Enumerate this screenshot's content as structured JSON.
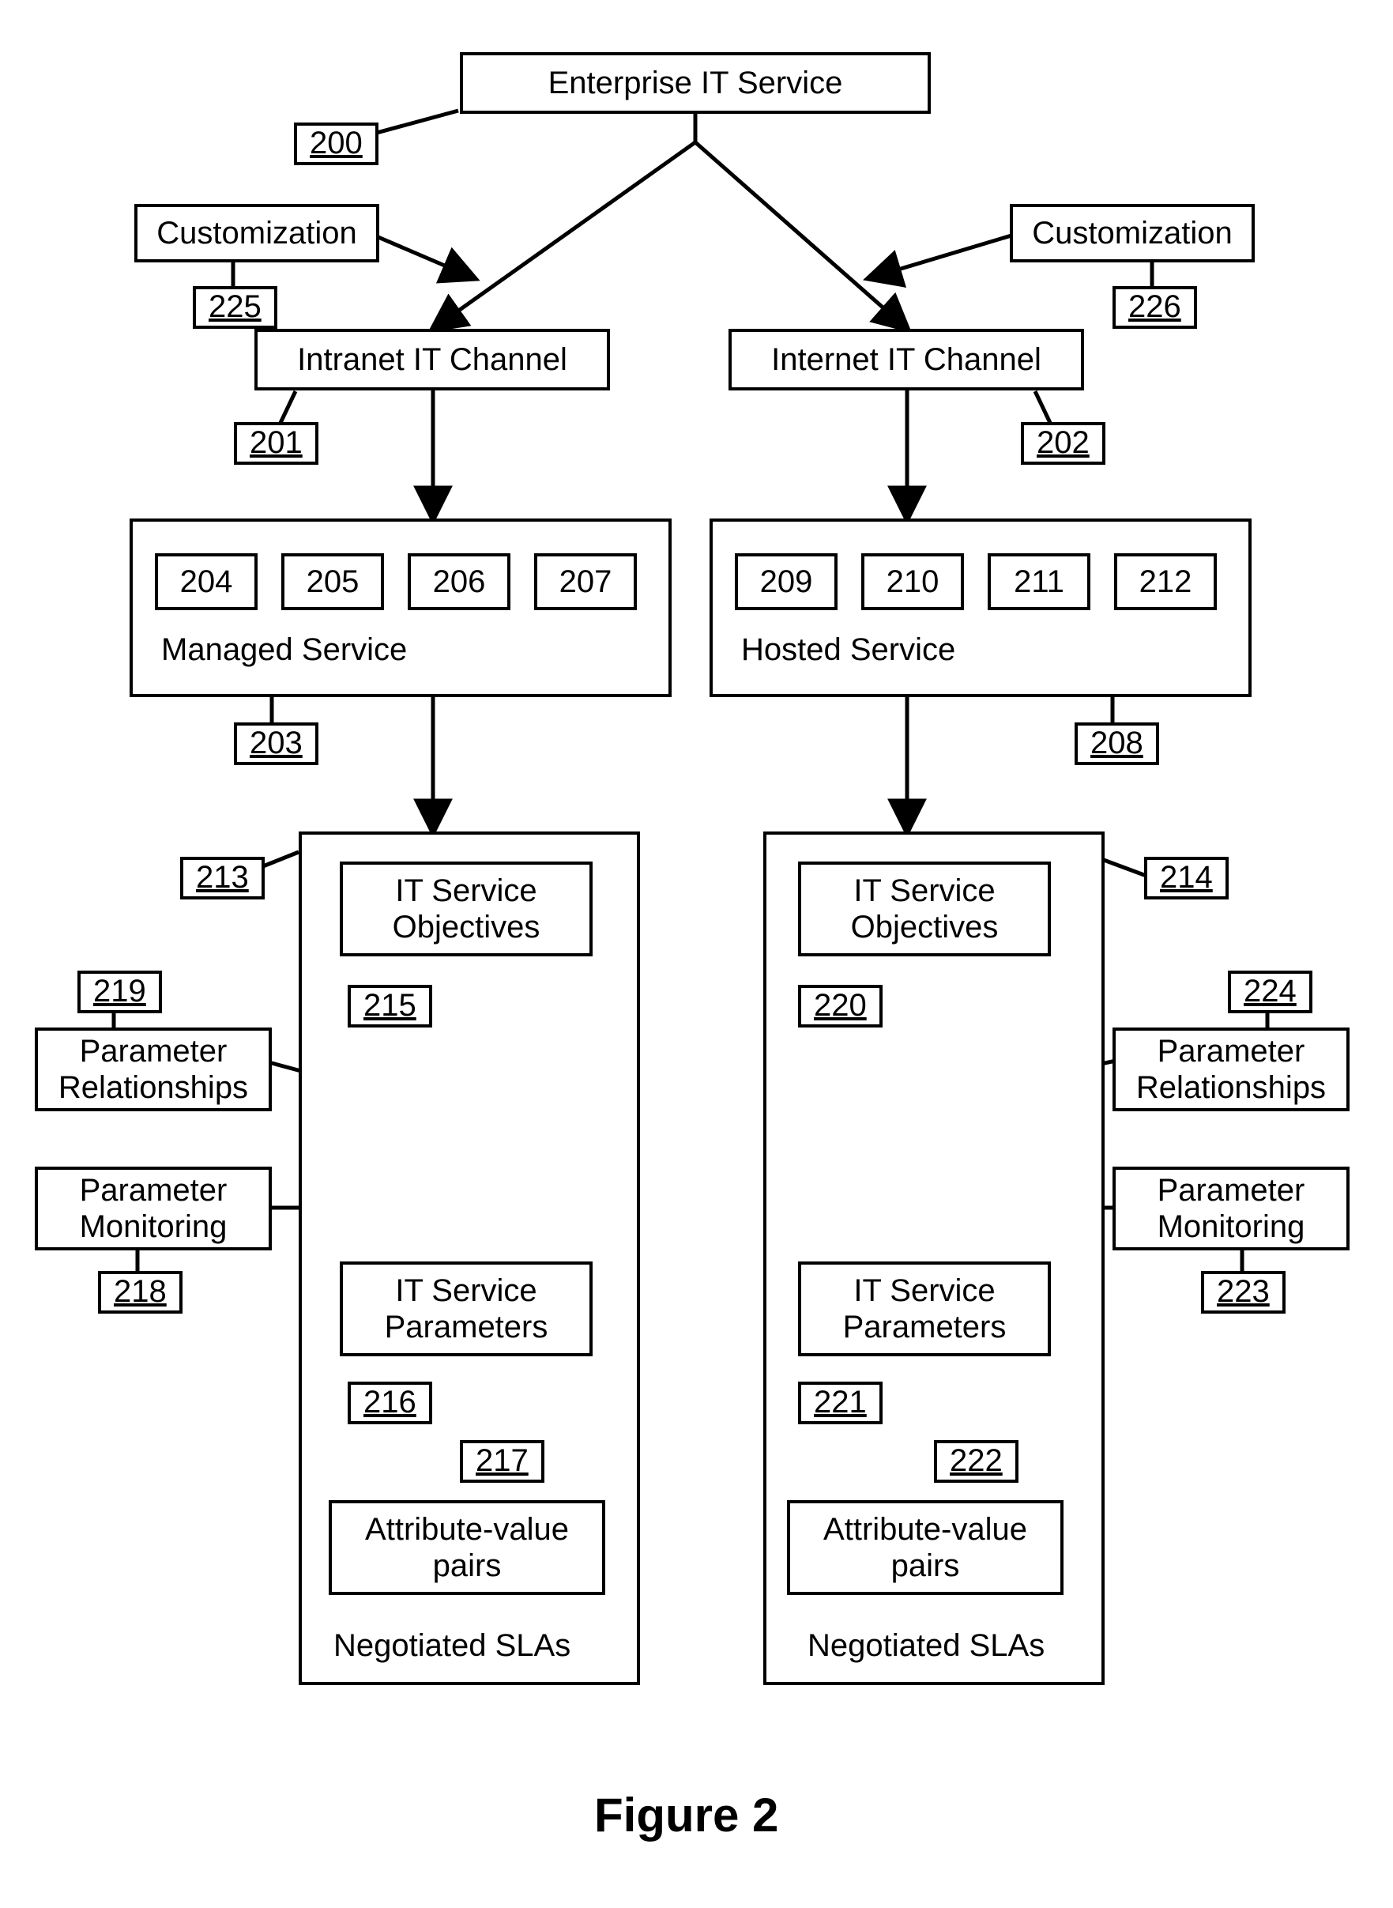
{
  "figure_caption": "Figure 2",
  "boxes": {
    "enterprise": "Enterprise IT Service",
    "cust_left": "Customization",
    "cust_right": "Customization",
    "intranet": "Intranet IT Channel",
    "internet": "Internet IT Channel",
    "managed_service": "Managed Service",
    "hosted_service": "Hosted Service",
    "objectives_left": "IT Service\nObjectives",
    "objectives_right": "IT Service\nObjectives",
    "params_left": "IT Service\nParameters",
    "params_right": "IT Service\nParameters",
    "attr_left": "Attribute-value\npairs",
    "attr_right": "Attribute-value\npairs",
    "param_rel_left": "Parameter\nRelationships",
    "param_rel_right": "Parameter\nRelationships",
    "param_mon_left": "Parameter\nMonitoring",
    "param_mon_right": "Parameter\nMonitoring",
    "neg_left": "Negotiated SLAs",
    "neg_right": "Negotiated SLAs"
  },
  "refs": {
    "r200": "200",
    "r201": "201",
    "r202": "202",
    "r203": "203",
    "r204": "204",
    "r205": "205",
    "r206": "206",
    "r207": "207",
    "r208": "208",
    "r209": "209",
    "r210": "210",
    "r211": "211",
    "r212": "212",
    "r213": "213",
    "r214": "214",
    "r215": "215",
    "r216": "216",
    "r217": "217",
    "r218": "218",
    "r219": "219",
    "r220": "220",
    "r221": "221",
    "r222": "222",
    "r223": "223",
    "r224": "224",
    "r225": "225",
    "r226": "226"
  }
}
